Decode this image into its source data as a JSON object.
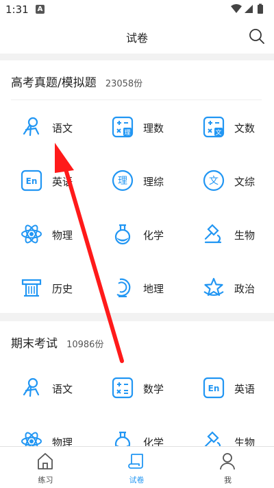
{
  "status": {
    "time": "1:31",
    "badge": "A"
  },
  "header": {
    "title": "试卷"
  },
  "sections": [
    {
      "title": "高考真题/模拟题",
      "count": "23058份",
      "items": [
        {
          "label": "语文",
          "icon": "book-reader-icon"
        },
        {
          "label": "理数",
          "icon": "calculator-li-icon"
        },
        {
          "label": "文数",
          "icon": "calculator-wen-icon"
        },
        {
          "label": "英语",
          "icon": "en-icon"
        },
        {
          "label": "理综",
          "icon": "li-circle-icon"
        },
        {
          "label": "文综",
          "icon": "wen-circle-icon"
        },
        {
          "label": "物理",
          "icon": "atom-icon"
        },
        {
          "label": "化学",
          "icon": "flask-icon"
        },
        {
          "label": "生物",
          "icon": "microscope-icon"
        },
        {
          "label": "历史",
          "icon": "column-icon"
        },
        {
          "label": "地理",
          "icon": "globe-icon"
        },
        {
          "label": "政治",
          "icon": "star-icon"
        }
      ]
    },
    {
      "title": "期末考试",
      "count": "10986份",
      "items": [
        {
          "label": "语文",
          "icon": "book-reader-icon"
        },
        {
          "label": "数学",
          "icon": "calculator-icon"
        },
        {
          "label": "英语",
          "icon": "en-icon"
        },
        {
          "label": "物理",
          "icon": "atom-icon"
        },
        {
          "label": "化学",
          "icon": "flask-icon"
        },
        {
          "label": "生物",
          "icon": "microscope-icon"
        }
      ]
    }
  ],
  "tabs": [
    {
      "label": "练习",
      "icon": "home-icon"
    },
    {
      "label": "试卷",
      "icon": "scroll-icon",
      "active": true
    },
    {
      "label": "我",
      "icon": "person-icon"
    }
  ],
  "colors": {
    "accent": "#2196f3",
    "annotation": "#ff1a1a"
  }
}
